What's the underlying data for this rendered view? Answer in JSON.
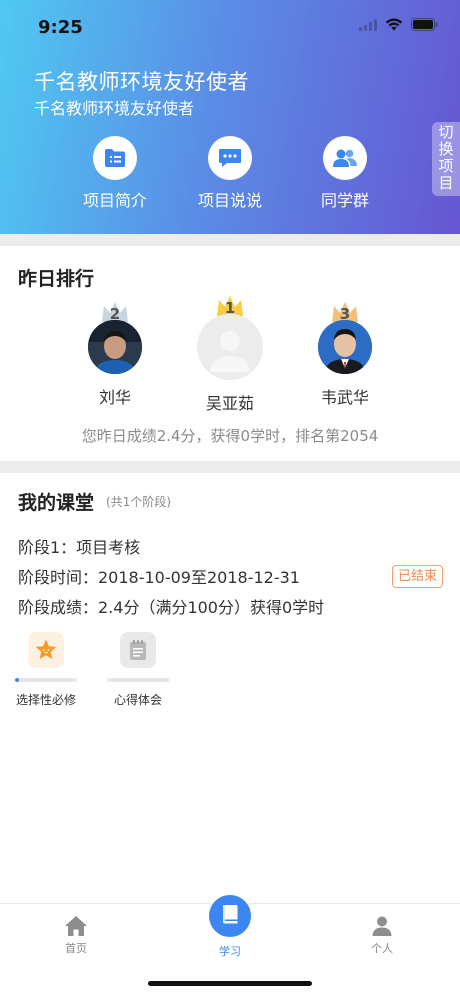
{
  "status_bar": {
    "time": "9:25"
  },
  "header": {
    "title": "千名教师环境友好使者",
    "subtitle": "千名教师环境友好使者",
    "switch_label": "切换项目",
    "buttons": [
      {
        "label": "项目简介",
        "icon": "folder-list-icon"
      },
      {
        "label": "项目说说",
        "icon": "chat-bubble-icon"
      },
      {
        "label": "同学群",
        "icon": "group-icon"
      }
    ]
  },
  "ranking": {
    "title": "昨日排行",
    "entries": [
      {
        "rank": "2",
        "name": "刘华"
      },
      {
        "rank": "1",
        "name": "吴亚茹"
      },
      {
        "rank": "3",
        "name": "韦武华"
      }
    ],
    "summary": "您昨日成绩2.4分，获得0学时，排名第2054"
  },
  "classroom": {
    "title": "我的课堂",
    "subtitle": "(共1个阶段)",
    "stage": "阶段1：项目考核",
    "period": "阶段时间：2018-10-09至2018-12-31",
    "score": "阶段成绩：2.4分（满分100分）获得0学时",
    "status_badge": "已结束",
    "modules": [
      {
        "label": "选择性必修",
        "icon": "star-icon",
        "progress": 0.06
      },
      {
        "label": "心得体会",
        "icon": "notepad-icon",
        "progress": 0
      }
    ]
  },
  "tabbar": {
    "tabs": [
      {
        "label": "首页",
        "icon": "home-icon"
      },
      {
        "label": "学习",
        "icon": "book-icon"
      },
      {
        "label": "个人",
        "icon": "person-icon"
      }
    ]
  },
  "colors": {
    "accent": "#3b86f1",
    "header_start": "#4fc9f2",
    "header_end": "#6656d2",
    "badge": "#f08a4b"
  }
}
